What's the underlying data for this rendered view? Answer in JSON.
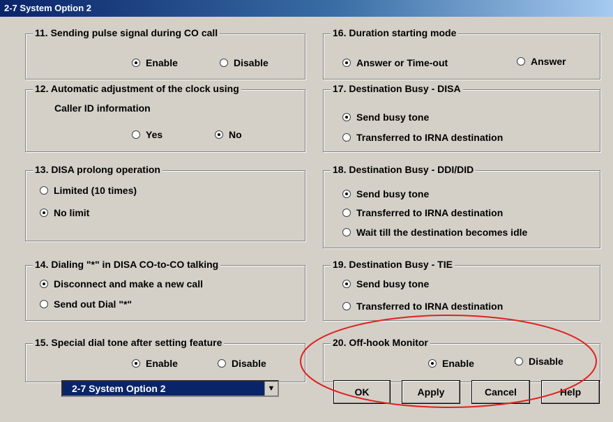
{
  "window": {
    "title": "2-7 System Option 2"
  },
  "groups": {
    "g11": {
      "title": "11. Sending pulse signal during CO call",
      "options": [
        "Enable",
        "Disable"
      ],
      "selected": 0
    },
    "g12": {
      "title": "12. Automatic adjustment of the clock using",
      "title_line2": "Caller ID information",
      "options": [
        "Yes",
        "No"
      ],
      "selected": 1
    },
    "g13": {
      "title": "13. DISA prolong operation",
      "options": [
        "Limited (10 times)",
        "No limit"
      ],
      "selected": 1
    },
    "g14": {
      "title": "14. Dialing \"*\" in DISA CO-to-CO talking",
      "options": [
        "Disconnect and make a new call",
        "Send out Dial \"*\""
      ],
      "selected": 0
    },
    "g15": {
      "title": "15. Special dial tone after setting feature",
      "options": [
        "Enable",
        "Disable"
      ],
      "selected": 0
    },
    "g16": {
      "title": "16. Duration starting mode",
      "options": [
        "Answer or Time-out",
        "Answer"
      ],
      "selected": 0
    },
    "g17": {
      "title": "17. Destination Busy - DISA",
      "options": [
        "Send busy tone",
        "Transferred to IRNA destination"
      ],
      "selected": 0
    },
    "g18": {
      "title": "18. Destination Busy - DDI/DID",
      "options": [
        "Send busy tone",
        "Transferred to IRNA destination",
        "Wait till the destination becomes idle"
      ],
      "selected": 0
    },
    "g19": {
      "title": "19. Destination Busy - TIE",
      "options": [
        "Send busy tone",
        "Transferred to IRNA destination"
      ],
      "selected": 0
    },
    "g20": {
      "title": "20. Off-hook Monitor",
      "options": [
        "Enable",
        "Disable"
      ],
      "selected": 0
    }
  },
  "footer": {
    "page_select": "2-7 System Option 2",
    "ok_label": "OK",
    "apply_label": "Apply",
    "cancel_label": "Cancel",
    "help_label": "Help"
  },
  "colors": {
    "dialog_bg": "#d4d0c8",
    "title_start": "#0a246a",
    "highlight_ellipse": "#e02020"
  }
}
